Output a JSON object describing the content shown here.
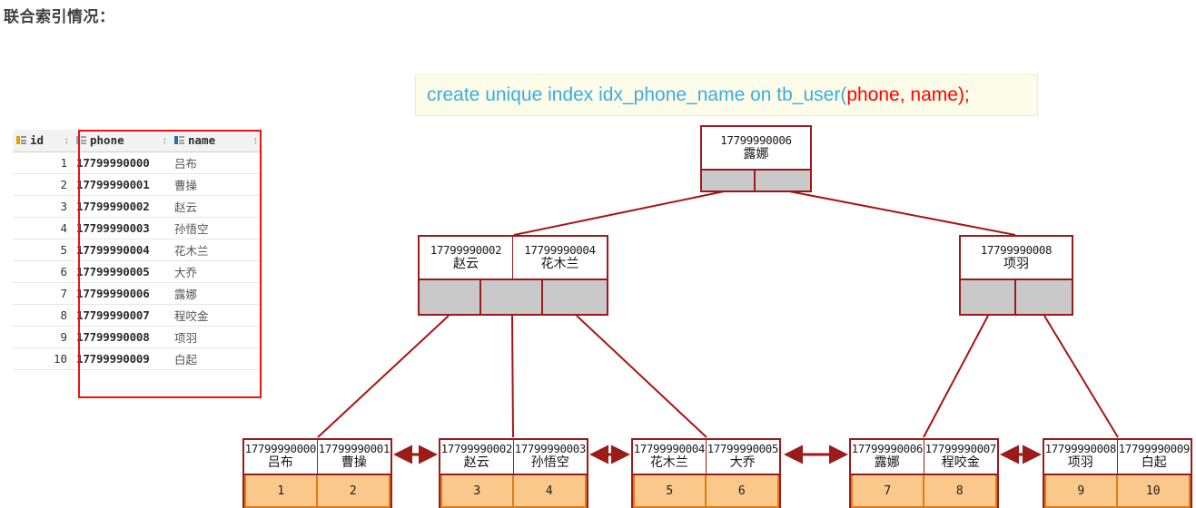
{
  "page": {
    "title": "联合索引情况："
  },
  "sql": {
    "prefix": "create unique index idx_phone_name on tb_user(",
    "highlight": "phone, name",
    "suffix": ");",
    "blue_color": "#3aade1",
    "red_color": "#ff0000",
    "background": "#fdfce8"
  },
  "table": {
    "name": "tb_user",
    "highlight_color": "#ee1111",
    "columns": [
      {
        "key": "id",
        "label": "id",
        "icon": "primary-key-icon",
        "sorter": "↕"
      },
      {
        "key": "phone",
        "label": "phone",
        "icon": "column-light-icon",
        "sorter": "↕"
      },
      {
        "key": "name",
        "label": "name",
        "icon": "column-dark-icon",
        "sorter": "↕"
      }
    ],
    "rows": [
      {
        "id": "1",
        "phone": "17799990000",
        "name": "吕布"
      },
      {
        "id": "2",
        "phone": "17799990001",
        "name": "曹操"
      },
      {
        "id": "3",
        "phone": "17799990002",
        "name": "赵云"
      },
      {
        "id": "4",
        "phone": "17799990003",
        "name": "孙悟空"
      },
      {
        "id": "5",
        "phone": "17799990004",
        "name": "花木兰"
      },
      {
        "id": "6",
        "phone": "17799990005",
        "name": "大乔"
      },
      {
        "id": "7",
        "phone": "17799990006",
        "name": "露娜"
      },
      {
        "id": "8",
        "phone": "17799990007",
        "name": "程咬金"
      },
      {
        "id": "9",
        "phone": "17799990008",
        "name": "项羽"
      },
      {
        "id": "10",
        "phone": "17799990009",
        "name": "白起"
      }
    ]
  },
  "tree": {
    "structure": "b+tree",
    "node_border_color": "#9b1b1b",
    "pointer_fill": "#c9c9c9",
    "leaf_value_fill": "#fac88a",
    "leaf_value_border": "#e07b18",
    "root": {
      "keys": [
        {
          "phone": "17799990006",
          "name": "露娜"
        }
      ],
      "pointers": 2
    },
    "internal": [
      {
        "keys": [
          {
            "phone": "17799990002",
            "name": "赵云"
          },
          {
            "phone": "17799990004",
            "name": "花木兰"
          }
        ],
        "pointers": 3
      },
      {
        "keys": [
          {
            "phone": "17799990008",
            "name": "项羽"
          }
        ],
        "pointers": 2
      }
    ],
    "leaves": [
      {
        "keys": [
          {
            "phone": "17799990000",
            "name": "吕布"
          },
          {
            "phone": "17799990001",
            "name": "曹操"
          }
        ],
        "values": [
          "1",
          "2"
        ]
      },
      {
        "keys": [
          {
            "phone": "17799990002",
            "name": "赵云"
          },
          {
            "phone": "17799990003",
            "name": "孙悟空"
          }
        ],
        "values": [
          "3",
          "4"
        ]
      },
      {
        "keys": [
          {
            "phone": "17799990004",
            "name": "花木兰"
          },
          {
            "phone": "17799990005",
            "name": "大乔"
          }
        ],
        "values": [
          "5",
          "6"
        ]
      },
      {
        "keys": [
          {
            "phone": "17799990006",
            "name": "露娜"
          },
          {
            "phone": "17799990007",
            "name": "程咬金"
          }
        ],
        "values": [
          "7",
          "8"
        ]
      },
      {
        "keys": [
          {
            "phone": "17799990008",
            "name": "项羽"
          },
          {
            "phone": "17799990009",
            "name": "白起"
          }
        ],
        "values": [
          "9",
          "10"
        ]
      }
    ]
  }
}
